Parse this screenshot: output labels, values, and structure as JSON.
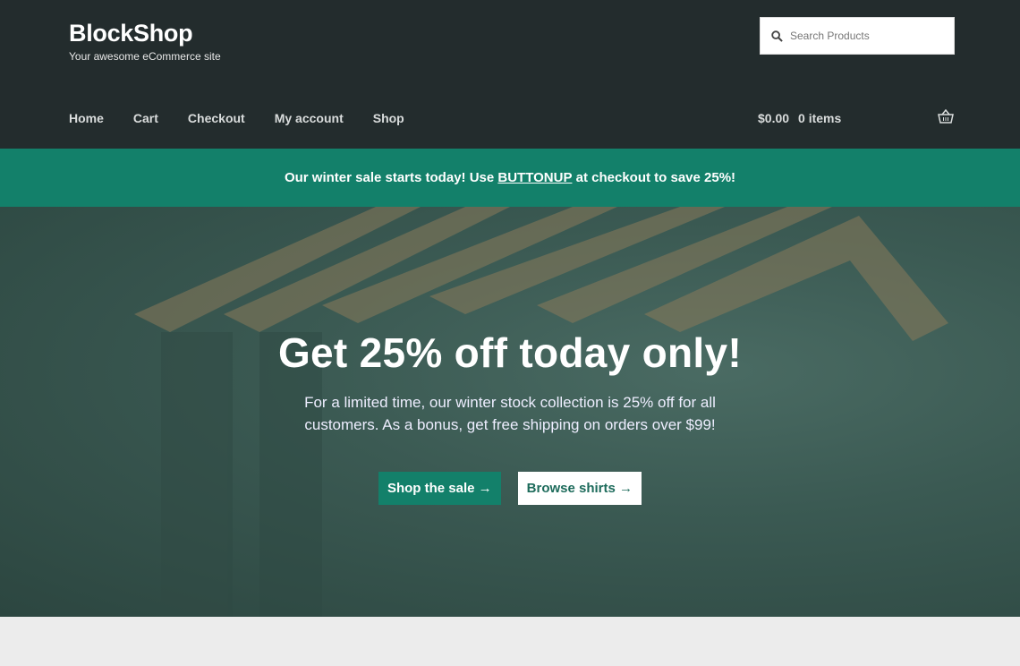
{
  "site": {
    "title": "BlockShop",
    "tagline": "Your awesome eCommerce site"
  },
  "search": {
    "placeholder": "Search Products"
  },
  "nav": [
    "Home",
    "Cart",
    "Checkout",
    "My account",
    "Shop"
  ],
  "cart": {
    "total": "$0.00",
    "items": "0 items"
  },
  "banner": {
    "before": "Our winter sale starts today! Use ",
    "code": "BUTTONUP",
    "after": " at checkout to save 25%!"
  },
  "hero": {
    "title": "Get 25% off today only!",
    "text": "For a limited time, our winter stock collection is 25% off for all customers. As a bonus, get free shipping on orders over $99!",
    "primary": "Shop the sale →",
    "secondary": "Browse shirts →"
  },
  "colors": {
    "header": "#232c2d",
    "accent": "#13806a"
  }
}
